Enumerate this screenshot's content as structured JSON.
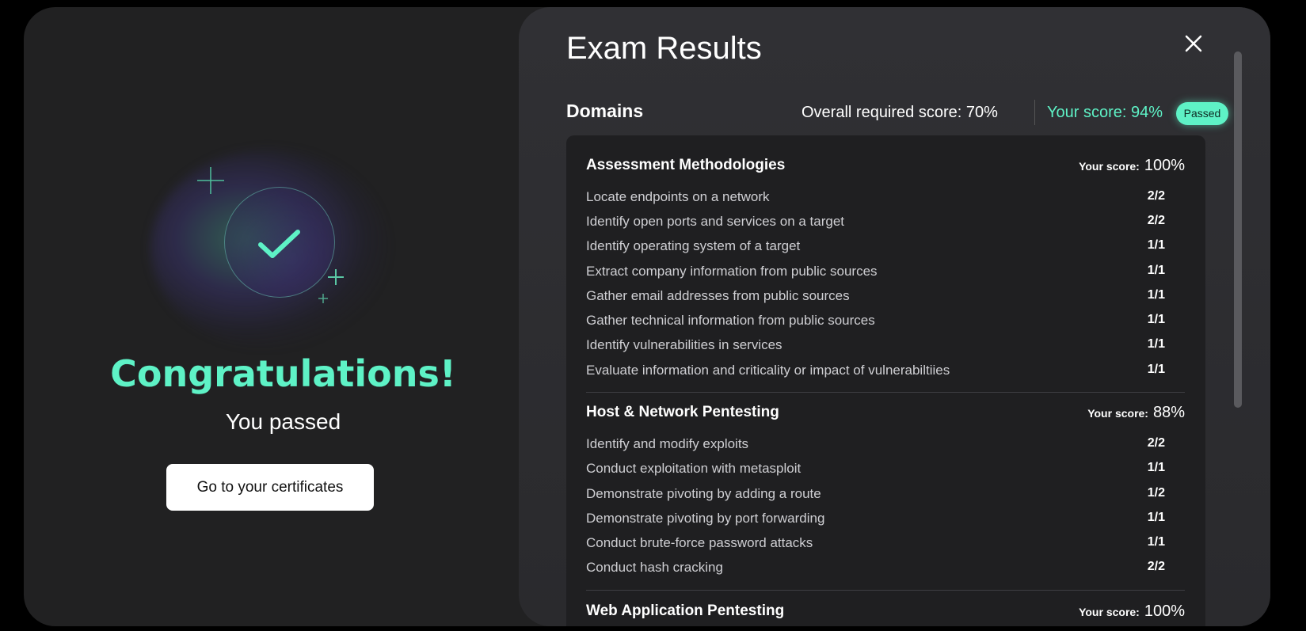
{
  "left": {
    "heading": "Congratulations!",
    "subheading": "You passed",
    "button_label": "Go to your certificates"
  },
  "right": {
    "title": "Exam Results",
    "domains_heading": "Domains",
    "required_score": "Overall required score: 70%",
    "your_score": "Your score: 94%",
    "status_badge": "Passed",
    "domains": [
      {
        "name": "Assessment Methodologies",
        "score_label": "Your score:",
        "score_value": "100%",
        "items": [
          {
            "label": "Locate endpoints on a network",
            "score": "2/2"
          },
          {
            "label": "Identify open ports and services on a target",
            "score": "2/2"
          },
          {
            "label": "Identify operating system of a target",
            "score": "1/1"
          },
          {
            "label": "Extract company information from public sources",
            "score": "1/1"
          },
          {
            "label": "Gather email addresses from public sources",
            "score": "1/1"
          },
          {
            "label": "Gather technical information from public sources",
            "score": "1/1"
          },
          {
            "label": "Identify vulnerabilities in services",
            "score": "1/1"
          },
          {
            "label": "Evaluate information and criticality or impact of vulnerabiltiies",
            "score": "1/1"
          }
        ]
      },
      {
        "name": "Host & Network Pentesting",
        "score_label": "Your score:",
        "score_value": "88%",
        "items": [
          {
            "label": "Identify and modify exploits",
            "score": "2/2"
          },
          {
            "label": "Conduct exploitation with metasploit",
            "score": "1/1"
          },
          {
            "label": "Demonstrate pivoting by adding a route",
            "score": "1/2"
          },
          {
            "label": "Demonstrate pivoting by port forwarding",
            "score": "1/1"
          },
          {
            "label": "Conduct brute-force password attacks",
            "score": "1/1"
          },
          {
            "label": "Conduct hash cracking",
            "score": "2/2"
          }
        ]
      },
      {
        "name": "Web Application Pentesting",
        "score_label": "Your score:",
        "score_value": "100%",
        "items": []
      }
    ]
  },
  "icons": {
    "close": "close-icon",
    "check": "checkmark-icon",
    "sparkle": "sparkle-icon"
  },
  "colors": {
    "accent": "#5ef2c6",
    "background": "#212122",
    "panel": "#2e2e31"
  }
}
